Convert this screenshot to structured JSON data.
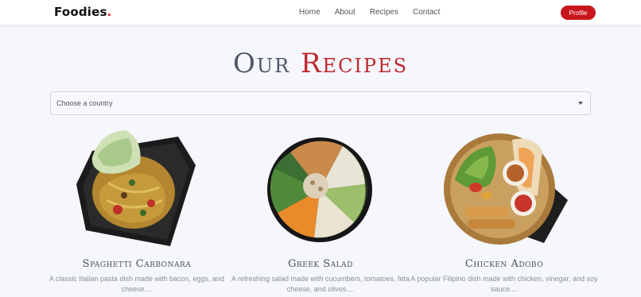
{
  "brand": {
    "name": "Foodies",
    "dot": "."
  },
  "nav": {
    "links": [
      "Home",
      "About",
      "Recipes",
      "Contact"
    ],
    "profile_label": "Profile"
  },
  "hero": {
    "title_word1": "Our",
    "title_word2": "Recipes"
  },
  "filter": {
    "placeholder": "Choose a country"
  },
  "recipes": [
    {
      "name": "Spaghetti Carbonara",
      "description": "A classic Italian pasta dish made with bacon, eggs, and cheese...."
    },
    {
      "name": "Greek Salad",
      "description": "A refreshing salad made with cucumbers, tomatoes, feta cheese, and olives...."
    },
    {
      "name": "Chicken Adobo",
      "description": "A popular Filipino dish made with chicken, vinegar, and soy sauce...."
    }
  ],
  "colors": {
    "accent": "#c8161d",
    "title_dark": "#4e5466",
    "title_red": "#c0282e",
    "page_bg": "#f5f7fc"
  }
}
